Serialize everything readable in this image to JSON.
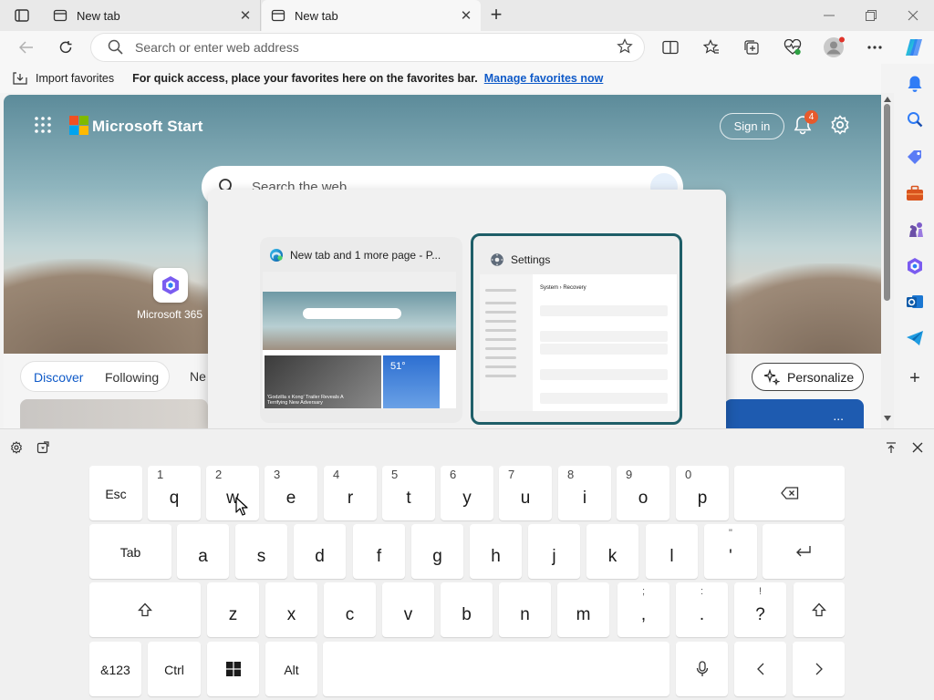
{
  "tabs": [
    {
      "title": "New tab"
    },
    {
      "title": "New tab"
    }
  ],
  "address_bar": {
    "placeholder": "Search or enter web address"
  },
  "favorites_bar": {
    "import_label": "Import favorites",
    "message": "For quick access, place your favorites here on the favorites bar.",
    "manage_link": "Manage favorites now"
  },
  "start_page": {
    "brand": "Microsoft Start",
    "sign_in": "Sign in",
    "notification_count": "4",
    "search_placeholder": "Search the web",
    "quick_link": "Microsoft 365",
    "feed_tabs": [
      "Discover",
      "Following",
      "Ne"
    ],
    "personalize": "Personalize",
    "more": "..."
  },
  "task_switcher": {
    "windows": [
      {
        "title": "New tab and 1 more page - P...",
        "preview_headline": "'Godzilla x Kong' Trailer Reveals A Terrifying New Adversary",
        "preview_temp": "51°"
      },
      {
        "title": "Settings",
        "preview_heading": "System › Recovery"
      }
    ]
  },
  "keyboard": {
    "rows": [
      [
        {
          "label": "Esc"
        },
        {
          "label": "q",
          "sub": "1"
        },
        {
          "label": "w",
          "sub": "2"
        },
        {
          "label": "e",
          "sub": "3"
        },
        {
          "label": "r",
          "sub": "4"
        },
        {
          "label": "t",
          "sub": "5"
        },
        {
          "label": "y",
          "sub": "6"
        },
        {
          "label": "u",
          "sub": "7"
        },
        {
          "label": "i",
          "sub": "8"
        },
        {
          "label": "o",
          "sub": "9"
        },
        {
          "label": "p",
          "sub": "0"
        }
      ],
      [
        {
          "label": "Tab"
        },
        {
          "label": "a"
        },
        {
          "label": "s"
        },
        {
          "label": "d"
        },
        {
          "label": "f"
        },
        {
          "label": "g"
        },
        {
          "label": "h"
        },
        {
          "label": "j"
        },
        {
          "label": "k"
        },
        {
          "label": "l"
        },
        {
          "label": "'",
          "alt": "\""
        }
      ],
      [
        {
          "label": "z"
        },
        {
          "label": "x"
        },
        {
          "label": "c"
        },
        {
          "label": "v"
        },
        {
          "label": "b"
        },
        {
          "label": "n"
        },
        {
          "label": "m"
        },
        {
          "label": ",",
          "alt": ";"
        },
        {
          "label": ".",
          "alt": ":"
        },
        {
          "label": "?",
          "alt": "!"
        }
      ],
      [
        {
          "label": "&123"
        },
        {
          "label": "Ctrl"
        },
        {
          "label": "Alt"
        }
      ]
    ]
  },
  "colors": {
    "accent": "#0f5ac8",
    "switcher_focus": "#1e5e68",
    "notification_badge": "#e65a2c"
  }
}
